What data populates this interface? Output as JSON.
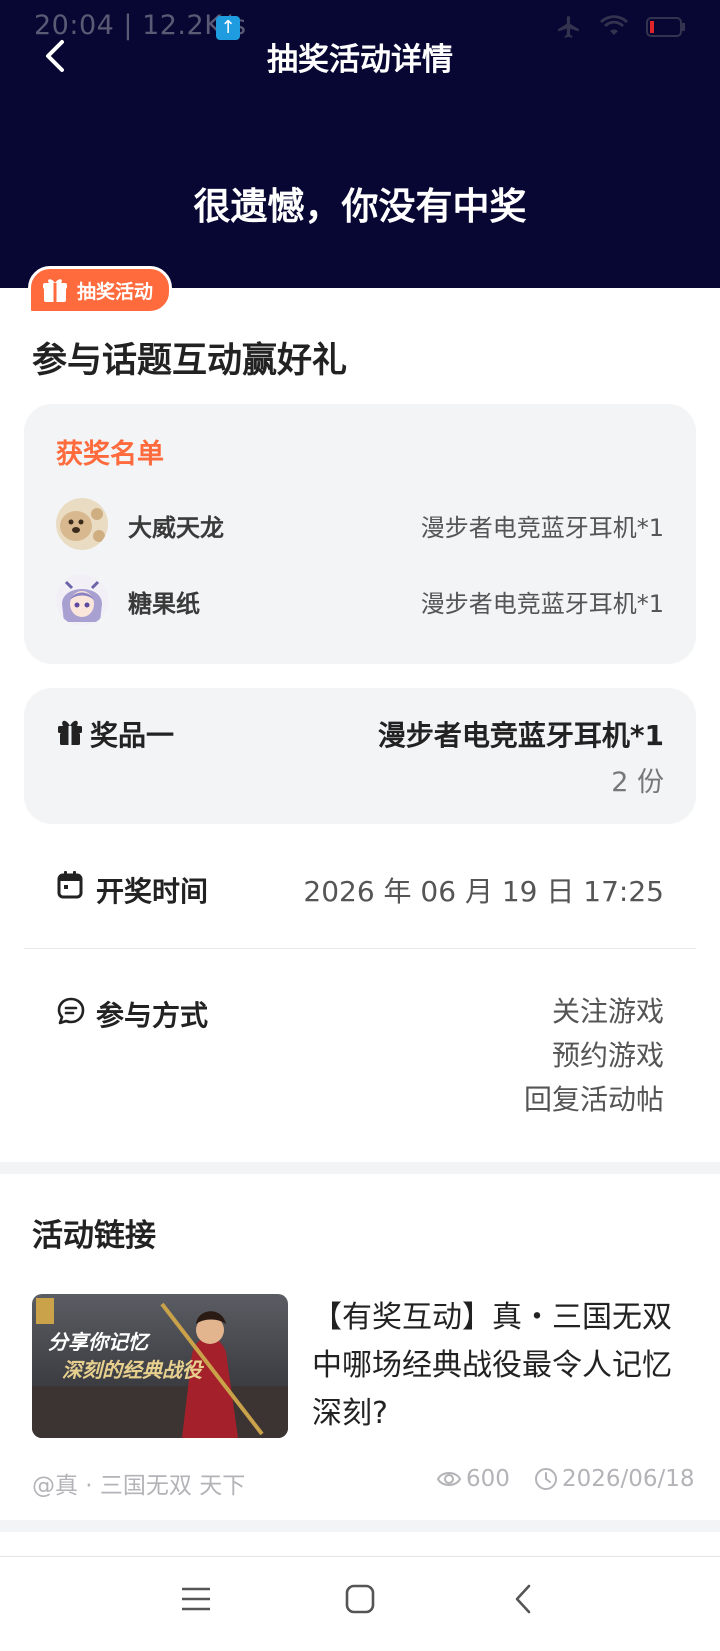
{
  "status_bar": {
    "time_speed": "20:04 | 12.2K/s",
    "upload_glyph": "↑",
    "icons": [
      "airplane-icon",
      "wifi-icon",
      "battery-icon"
    ]
  },
  "header": {
    "title": "抽奖活动详情",
    "result": "很遗憾，你没有中奖",
    "back_icon": "chevron-left-icon",
    "background_color": "#080733"
  },
  "activity": {
    "badge_label": "抽奖活动",
    "title": "参与话题互动赢好礼",
    "accent_color": "#ff6b3d"
  },
  "winners": {
    "heading": "获奖名单",
    "items": [
      {
        "name": "大威天龙",
        "prize": "漫步者电竞蓝牙耳机*1",
        "avatar": "dog-avatar"
      },
      {
        "name": "糖果纸",
        "prize": "漫步者电竞蓝牙耳机*1",
        "avatar": "anime-avatar"
      }
    ]
  },
  "prize": {
    "label": "奖品一",
    "name": "漫步者电竞蓝牙耳机*1",
    "count": "2 份",
    "icon": "gift-icon"
  },
  "draw_time": {
    "label": "开奖时间",
    "value": "2026 年 06 月 19 日 17:25",
    "icon": "calendar-icon"
  },
  "participation": {
    "label": "参与方式",
    "methods": [
      "关注游戏",
      "预约游戏",
      "回复活动帖"
    ],
    "icon": "chat-icon"
  },
  "links": {
    "heading": "活动链接",
    "post": {
      "title": "【有奖互动】真・三国无双中哪场经典战役最令人记忆深刻?",
      "thumbnail_text_1": "分享你记忆",
      "thumbnail_text_2": "深刻的经典战役",
      "author": "@真 · 三国无双 天下",
      "views": "600",
      "date": "2026/06/18"
    }
  },
  "navbar": {
    "icons": [
      "menu-icon",
      "home-icon",
      "back-icon"
    ]
  }
}
